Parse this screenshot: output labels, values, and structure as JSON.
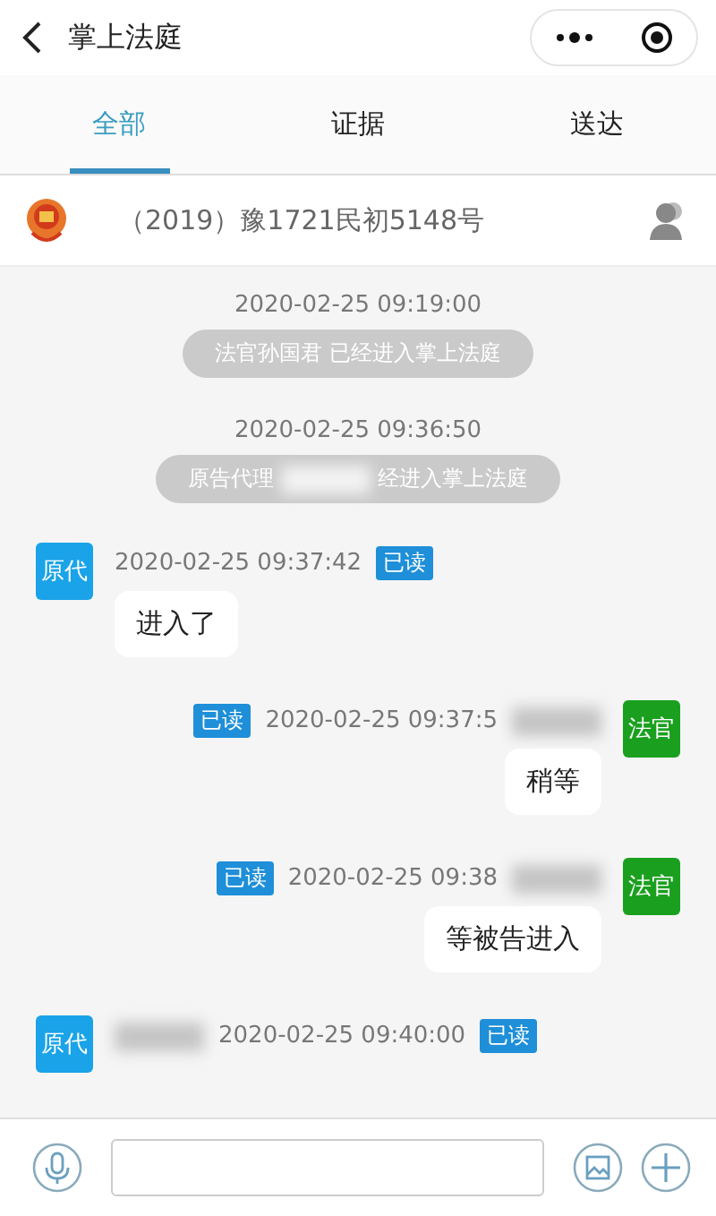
{
  "header": {
    "title": "掌上法庭"
  },
  "tabs": [
    {
      "label": "全部",
      "selected": true
    },
    {
      "label": "证据",
      "selected": false
    },
    {
      "label": "送达",
      "selected": false
    }
  ],
  "case": {
    "number": "（2019）豫1721民初5148号"
  },
  "messages": [
    {
      "kind": "system",
      "time": "2020-02-25 09:19:00",
      "parts": [
        "法官孙国君 已经进入掌上法庭"
      ]
    },
    {
      "kind": "system",
      "time": "2020-02-25 09:36:50",
      "parts": [
        "原告代理",
        "经进入掌上法庭"
      ]
    },
    {
      "kind": "received",
      "sender": "原代",
      "color": "#1aa3e8",
      "time": "2020-02-25 09:37:42",
      "read": "已读",
      "redacted": false,
      "text": "进入了"
    },
    {
      "kind": "sent",
      "sender": "法官",
      "color": "#1aa01e",
      "time": "2020-02-25 09:37:5",
      "read": "已读",
      "redacted": true,
      "text": "稍等"
    },
    {
      "kind": "sent",
      "sender": "法官",
      "color": "#1aa01e",
      "time": "2020-02-25 09:38",
      "read": "已读",
      "redacted": true,
      "text": "等被告进入"
    },
    {
      "kind": "received",
      "sender": "原代",
      "color": "#1aa3e8",
      "time": "2020-02-25 09:40:00",
      "read": "已读",
      "redacted": true
    }
  ]
}
